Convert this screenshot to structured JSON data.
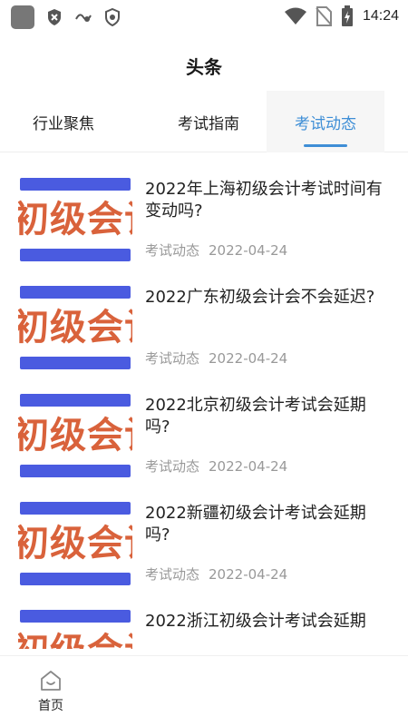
{
  "status_bar": {
    "time": "14:24",
    "left_icons": [
      "app-square-icon",
      "shield-x-icon",
      "app-logo-icon",
      "shield-check-icon"
    ],
    "right_icons": [
      "wifi-icon",
      "no-sim-icon",
      "battery-charging-icon"
    ]
  },
  "header": {
    "title": "头条"
  },
  "tabs": [
    {
      "label": "行业聚焦",
      "active": false
    },
    {
      "label": "考试指南",
      "active": false
    },
    {
      "label": "考试动态",
      "active": true
    }
  ],
  "articles": [
    {
      "title": "2022年上海初级会计考试时间有变动吗?",
      "category": "考试动态",
      "date": "2022-04-24",
      "thumb_text": "初级会计"
    },
    {
      "title": "2022广东初级会计会不会延迟?",
      "category": "考试动态",
      "date": "2022-04-24",
      "thumb_text": "初级会计"
    },
    {
      "title": "2022北京初级会计考试会延期吗?",
      "category": "考试动态",
      "date": "2022-04-24",
      "thumb_text": "初级会计"
    },
    {
      "title": "2022新疆初级会计考试会延期吗?",
      "category": "考试动态",
      "date": "2022-04-24",
      "thumb_text": "初级会计"
    },
    {
      "title": "2022浙江初级会计考试会延期",
      "category": "",
      "date": "",
      "thumb_text": "初级会计"
    }
  ],
  "bottom_nav": {
    "home_label": "首页"
  },
  "colors": {
    "accent": "#3e8ed6",
    "thumb_blue": "#4a5be0",
    "thumb_orange": "#d9623b",
    "meta_gray": "#999999"
  }
}
